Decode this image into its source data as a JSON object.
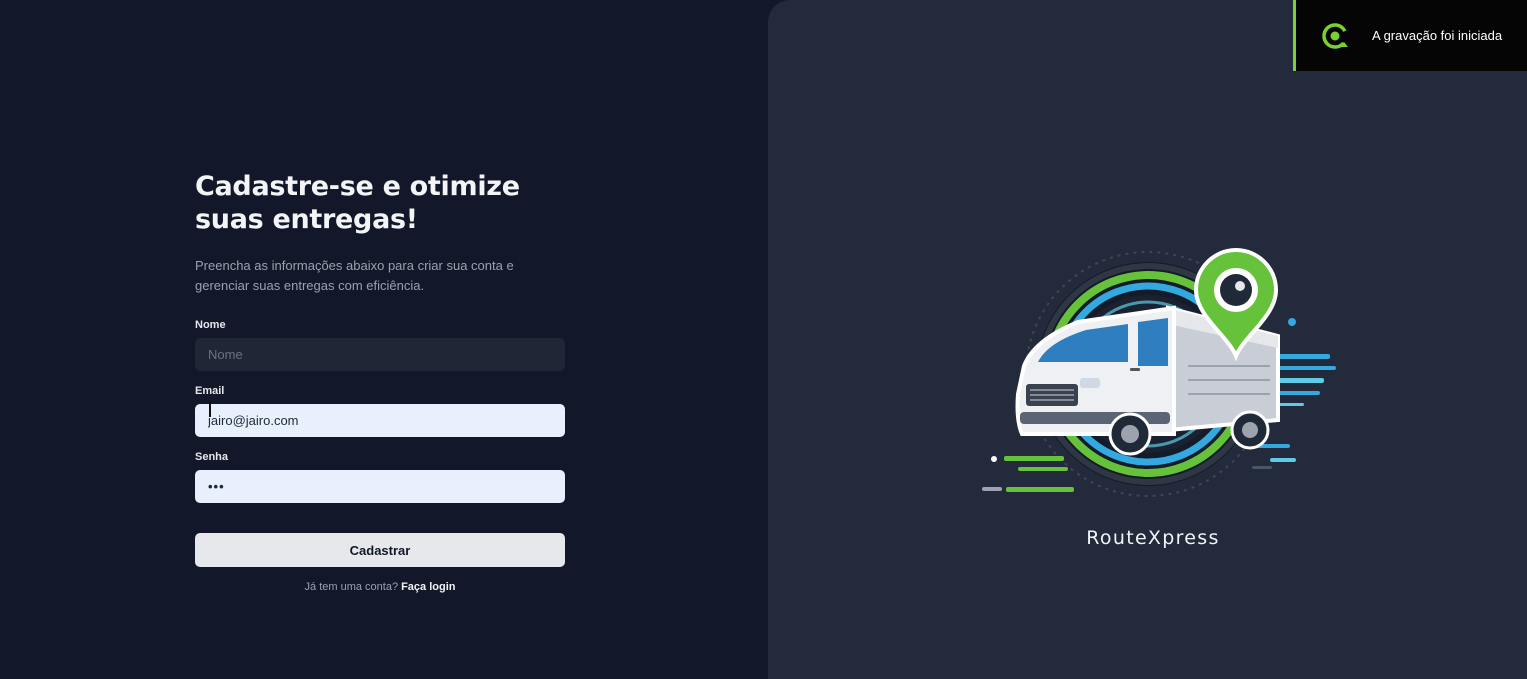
{
  "signup": {
    "title_line1": "Cadastre-se e otimize",
    "title_line2": "suas entregas!",
    "subtitle_line1": "Preencha as informações abaixo para criar sua conta e",
    "subtitle_line2": "gerenciar suas entregas com eficiência.",
    "name_label": "Nome",
    "name_placeholder": "Nome",
    "email_label": "Email",
    "email_value": "jairo@jairo.com",
    "password_label": "Senha",
    "password_value": "•••",
    "submit_label": "Cadastrar",
    "login_prompt": "Já tem uma conta?",
    "login_link": "Faça login"
  },
  "brand": {
    "name": "RouteXpress",
    "logo_icon": "delivery-truck-location-pin-icon"
  },
  "recording_toast": {
    "text": "A gravação foi iniciada",
    "icon": "recording-icon",
    "accent": "#7bd12f"
  },
  "colors": {
    "left_bg": "#121829",
    "right_bg": "#222a3b",
    "autofill_bg": "#e8f0fe",
    "logo_green": "#65c23a",
    "logo_blue": "#33a9e0"
  }
}
